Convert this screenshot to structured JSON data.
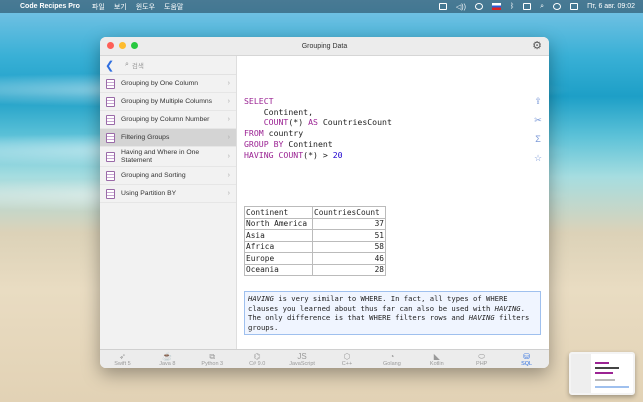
{
  "menubar": {
    "app_name": "Code Recipes Pro",
    "items": [
      "파일",
      "보기",
      "윈도우",
      "도움말"
    ],
    "clock": "Пт, 6 авг. 09:02"
  },
  "window": {
    "title": "Grouping Data"
  },
  "sidebar": {
    "search_placeholder": "검색",
    "items": [
      {
        "label": "Grouping by One Column",
        "selected": false
      },
      {
        "label": "Grouping by Multiple Columns",
        "selected": false
      },
      {
        "label": "Grouping by Column Number",
        "selected": false
      },
      {
        "label": "Filtering Groups",
        "selected": true
      },
      {
        "label": "Having and Where in One Statement",
        "selected": false
      },
      {
        "label": "Grouping and Sorting",
        "selected": false
      },
      {
        "label": "Using Partition BY",
        "selected": false
      }
    ]
  },
  "code": {
    "line1_kw": "SELECT",
    "line2": "    Continent,",
    "line3_kw1": "    COUNT",
    "line3_rest": "(*) ",
    "line3_kw2": "AS",
    "line3_tail": " CountriesCount",
    "line4_kw": "FROM",
    "line4_rest": " country",
    "line5_kw": "GROUP BY",
    "line5_rest": " Continent",
    "line6_kw": "HAVING",
    "line6_mid_kw": " COUNT",
    "line6_rest": "(*) > ",
    "line6_num": "20"
  },
  "result_table": {
    "headers": [
      "Continent",
      "CountriesCount"
    ],
    "rows": [
      [
        "North America",
        "37"
      ],
      [
        "Asia",
        "51"
      ],
      [
        "Africa",
        "58"
      ],
      [
        "Europe",
        "46"
      ],
      [
        "Oceania",
        "28"
      ]
    ]
  },
  "note": {
    "having1": "HAVING",
    "text1": " is very similar to WHERE. In fact, all types of WHERE clauses you learned about thus far can also be used with ",
    "having2": "HAVING",
    "text2": ". The only difference is that WHERE filters rows and ",
    "having3": "HAVING",
    "text3": " filters groups."
  },
  "tabs": [
    {
      "label": "Swift 5",
      "icon": "swift-icon",
      "glyph": "➶",
      "active": false
    },
    {
      "label": "Java 8",
      "icon": "java-icon",
      "glyph": "☕",
      "active": false
    },
    {
      "label": "Python 3",
      "icon": "python-icon",
      "glyph": "⧉",
      "active": false
    },
    {
      "label": "C# 9.0",
      "icon": "csharp-icon",
      "glyph": "⌬",
      "active": false
    },
    {
      "label": "JavaScript",
      "icon": "javascript-icon",
      "glyph": "JS",
      "active": false
    },
    {
      "label": "C++",
      "icon": "cpp-icon",
      "glyph": "⬡",
      "active": false
    },
    {
      "label": "Golang",
      "icon": "golang-icon",
      "glyph": "◔",
      "active": false
    },
    {
      "label": "Kotlin",
      "icon": "kotlin-icon",
      "glyph": "◣",
      "active": false
    },
    {
      "label": "PHP",
      "icon": "php-icon",
      "glyph": "⬭",
      "active": false
    },
    {
      "label": "SQL",
      "icon": "sql-icon",
      "glyph": "⛁",
      "active": true
    }
  ],
  "colors": {
    "accent": "#2f6fe0",
    "keyword": "#9b2393",
    "number": "#1c00cf",
    "selected_row": "#d4d4d4"
  }
}
